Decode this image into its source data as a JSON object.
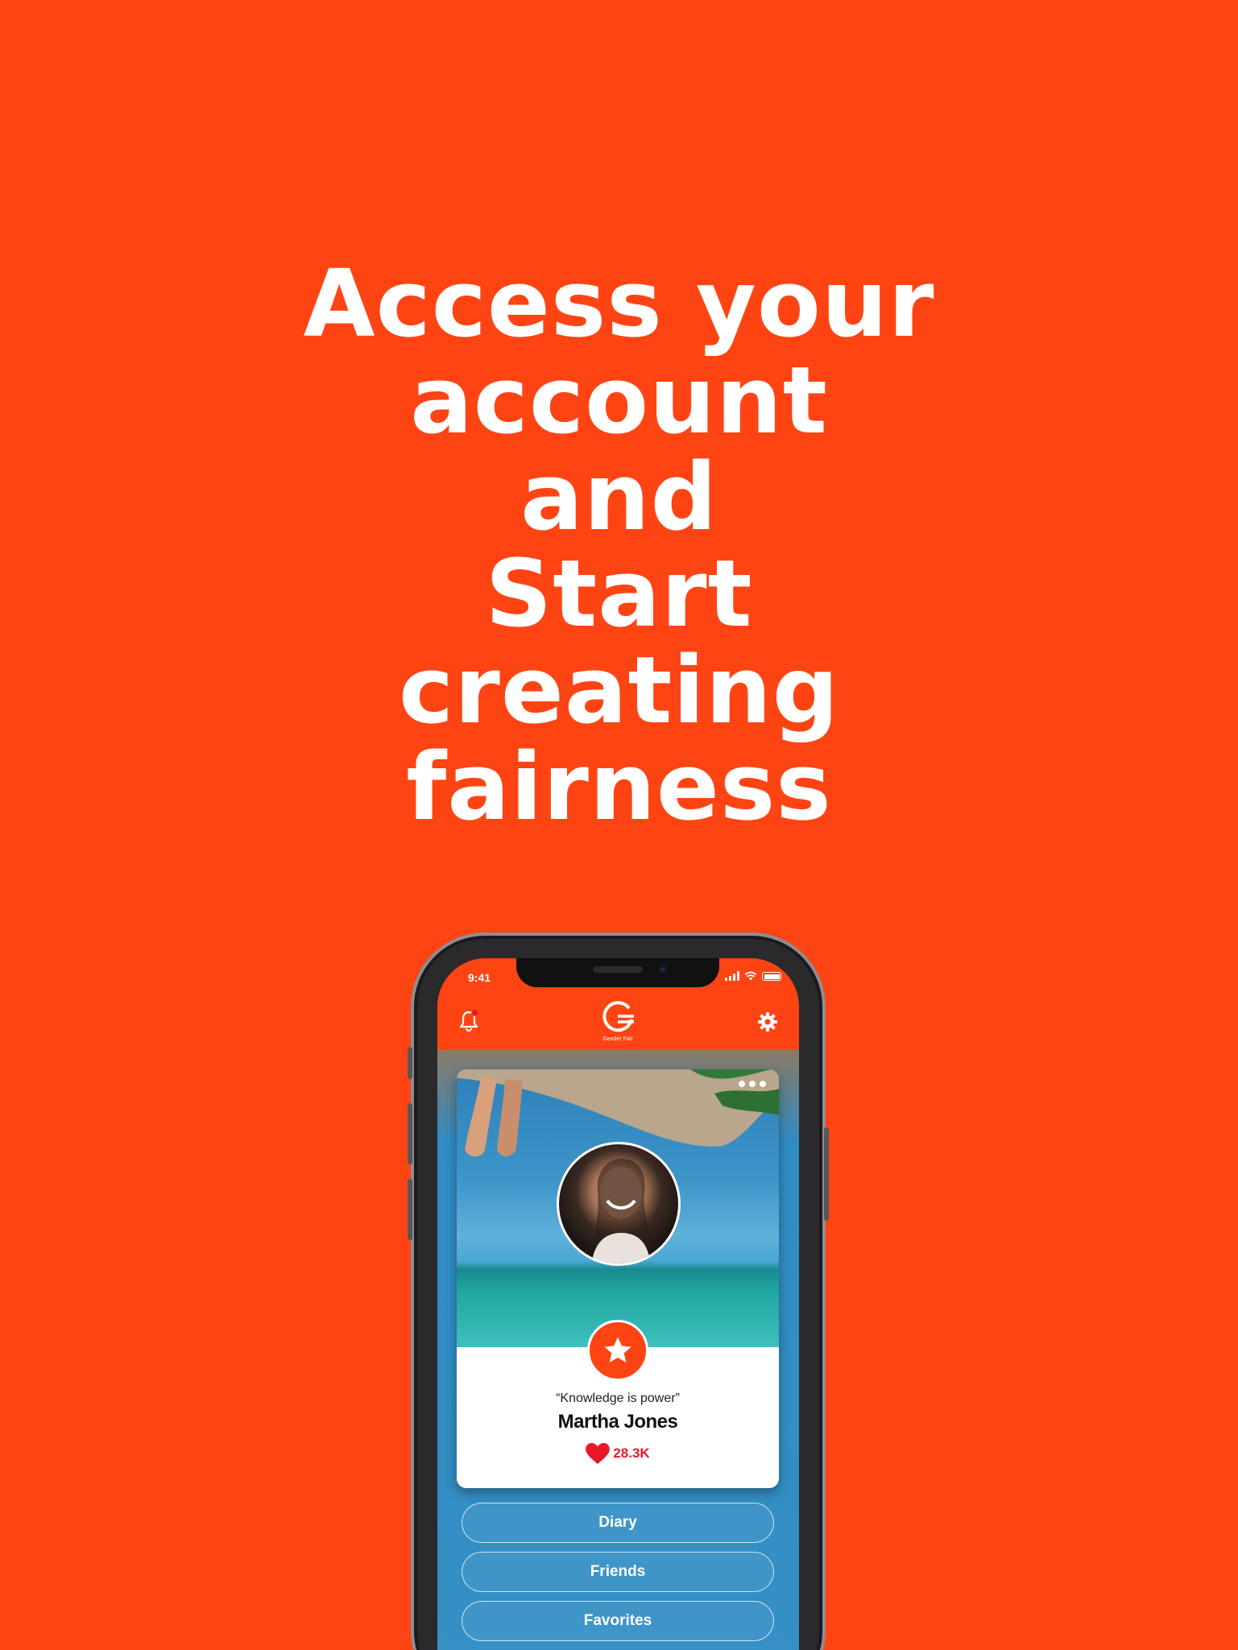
{
  "headline": [
    "Access your",
    "account",
    "and",
    "Start",
    "creating",
    "fairness"
  ],
  "status_bar": {
    "time": "9:41"
  },
  "app": {
    "logo_caption": "Gender Fair"
  },
  "profile": {
    "quote": "“Knowledge is power”",
    "name": "Martha Jones",
    "likes": "28.3K"
  },
  "menu": [
    "Diary",
    "Friends",
    "Favorites"
  ],
  "colors": {
    "brand": "#ff4413",
    "heart": "#e8182a"
  },
  "icons": [
    "bell-icon",
    "gender-fair-logo-icon",
    "gear-icon",
    "more-dots-icon",
    "star-icon",
    "heart-icon",
    "signal-icon",
    "wifi-icon",
    "battery-icon"
  ]
}
